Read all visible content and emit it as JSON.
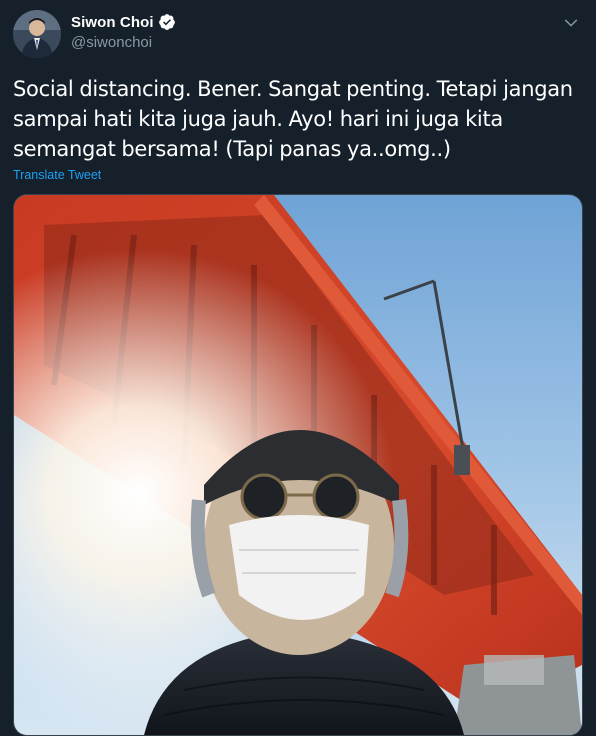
{
  "tweet": {
    "display_name": "Siwon Choi",
    "handle": "@siwonchoi",
    "text": "Social distancing. Bener. Sangat penting. Tetapi jangan sampai hati kita juga jauh. Ayo! hari ini juga kita semangat bersama! (Tapi panas ya..omg..)",
    "translate_label": "Translate Tweet"
  },
  "colors": {
    "background": "#15202b",
    "secondary_text": "#8899a6",
    "link": "#1da1f2",
    "verified": "#ffffff"
  },
  "icons": {
    "verified": "verified-badge-icon",
    "menu": "chevron-down-icon"
  },
  "media": {
    "kind": "photo",
    "subject": "selfie"
  }
}
